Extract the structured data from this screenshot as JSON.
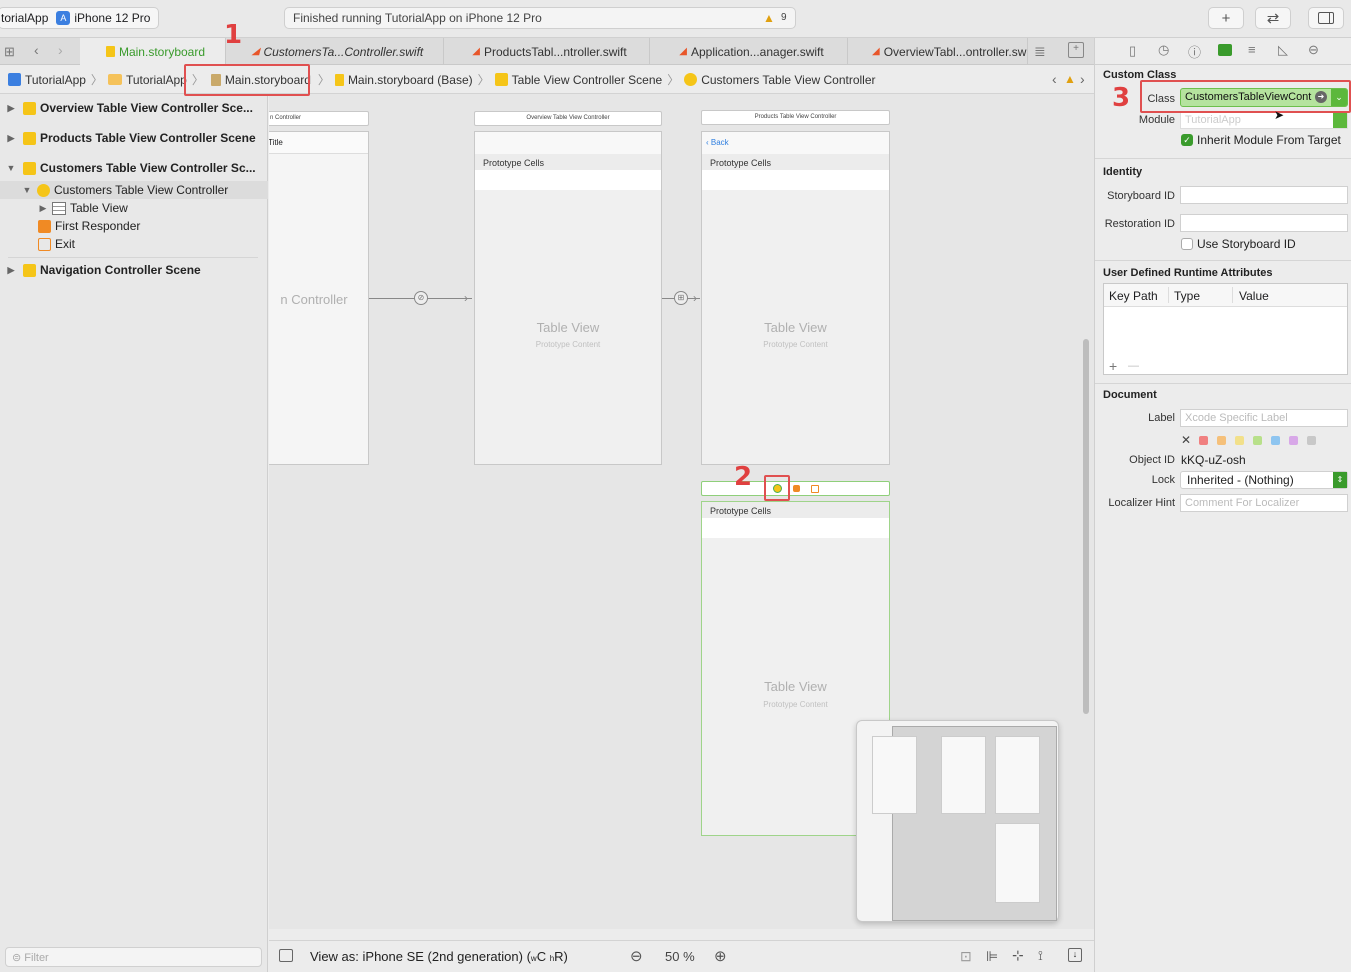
{
  "toolbar": {
    "scheme_app": "torialApp",
    "scheme_device": "iPhone 12 Pro",
    "status_text": "Finished running TutorialApp on iPhone 12 Pro",
    "warning_count": "9"
  },
  "tabs": [
    {
      "label": "Main.storyboard"
    },
    {
      "label": "CustomersTa...Controller.swift"
    },
    {
      "label": "ProductsTabl...ntroller.swift"
    },
    {
      "label": "Application...anager.swift"
    },
    {
      "label": "OverviewTabl...ontroller.sw"
    }
  ],
  "breadcrumb": [
    "TutorialApp",
    "TutorialApp",
    "Main.storyboard",
    "Main.storyboard (Base)",
    "Table View Controller Scene",
    "Customers Table View Controller"
  ],
  "navigator": {
    "items": [
      {
        "label": "Overview Table View Controller Sce..."
      },
      {
        "label": "Products Table View Controller Scene"
      },
      {
        "label": "Customers Table View Controller Sc..."
      },
      {
        "label": "Customers Table View Controller"
      },
      {
        "label": "Table View"
      },
      {
        "label": "First Responder"
      },
      {
        "label": "Exit"
      },
      {
        "label": "Navigation Controller Scene"
      }
    ],
    "filter_placeholder": "Filter"
  },
  "canvas": {
    "nav_controller_header": "n Controller",
    "nav_title": "Title",
    "nav_controller_label": "n Controller",
    "overview_header": "Overview Table View Controller",
    "products_header": "Products Table View Controller",
    "back_label": "Back",
    "prototype_cells": "Prototype Cells",
    "table_view": "Table View",
    "prototype_content": "Prototype Content"
  },
  "bottom": {
    "view_as": "View as: iPhone SE (2nd generation) (",
    "size_w": "w",
    "size_c": "C",
    "size_h": "h",
    "size_r": "R)",
    "zoom": "50 %"
  },
  "inspector": {
    "custom_class_title": "Custom Class",
    "class_label": "Class",
    "class_value": "CustomersTableViewCont",
    "module_label": "Module",
    "module_placeholder": "TutorialApp",
    "inherit_label": "Inherit Module From Target",
    "identity_title": "Identity",
    "storyboard_id_label": "Storyboard ID",
    "restoration_id_label": "Restoration ID",
    "use_storyboard_id_label": "Use Storyboard ID",
    "runtime_title": "User Defined Runtime Attributes",
    "col_key_path": "Key Path",
    "col_type": "Type",
    "col_value": "Value",
    "add_symbol": "+",
    "remove_symbol": "—",
    "document_title": "Document",
    "label_label": "Label",
    "label_placeholder": "Xcode Specific Label",
    "object_id_label": "Object ID",
    "object_id_value": "kKQ-uZ-osh",
    "lock_label": "Lock",
    "lock_value": "Inherited - (Nothing)",
    "localizer_label": "Localizer Hint",
    "localizer_placeholder": "Comment For Localizer",
    "label_colors": [
      "#f08080",
      "#f5c07a",
      "#f2e08a",
      "#b8e08a",
      "#8ec5f0",
      "#d8a8e8",
      "#c8c8c8"
    ]
  },
  "callouts": [
    "1",
    "2",
    "3"
  ],
  "colors": {
    "accent_green": "#3a9b2c",
    "callout_red": "#e04040",
    "storyboard_yellow": "#f5c518"
  }
}
